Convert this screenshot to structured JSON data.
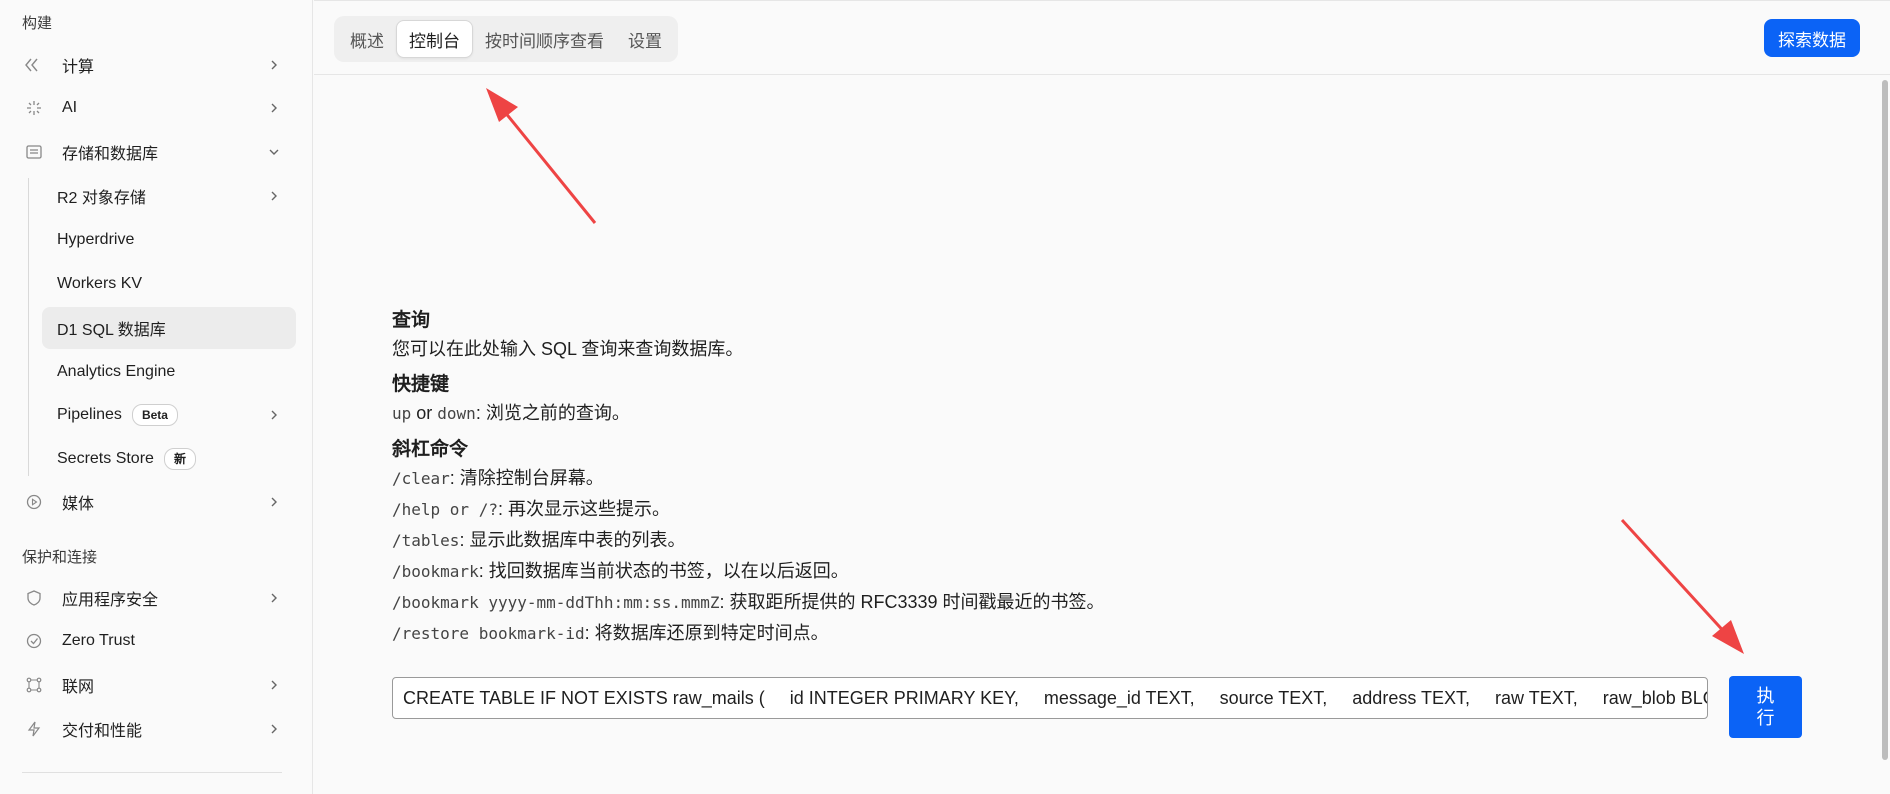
{
  "sidebar": {
    "section_build": "构建",
    "section_protect": "保护和连接",
    "items": {
      "compute": "计算",
      "ai": "AI",
      "storage": "存储和数据库",
      "media": "媒体",
      "app_security": "应用程序安全",
      "zero_trust": "Zero Trust",
      "network": "联网",
      "delivery": "交付和性能"
    },
    "storage_sub": {
      "r2": "R2 对象存储",
      "hyperdrive": "Hyperdrive",
      "workers_kv": "Workers KV",
      "d1": "D1 SQL 数据库",
      "analytics": "Analytics Engine",
      "pipelines": "Pipelines",
      "pipelines_badge": "Beta",
      "secrets": "Secrets Store",
      "secrets_badge": "新"
    }
  },
  "tabs": {
    "overview": "概述",
    "console": "控制台",
    "time_travel": "按时间顺序查看",
    "settings": "设置"
  },
  "explore_button": "探索数据",
  "help": {
    "query_title": "查询",
    "query_desc": "您可以在此处输入 SQL 查询来查询数据库。",
    "shortcut_title": "快捷键",
    "shortcut_up": "up",
    "shortcut_or": " or ",
    "shortcut_down": "down",
    "shortcut_desc": ": 浏览之前的查询。",
    "slash_title": "斜杠命令",
    "cmds": [
      {
        "cmd": "/clear",
        "desc": ": 清除控制台屏幕。"
      },
      {
        "cmd": "/help or /?",
        "desc": ": 再次显示这些提示。"
      },
      {
        "cmd": "/tables",
        "desc": ": 显示此数据库中表的列表。"
      },
      {
        "cmd": "/bookmark",
        "desc": ": 找回数据库当前状态的书签，以在以后返回。"
      },
      {
        "cmd": "/bookmark yyyy-mm-ddThh:mm:ss.mmmZ",
        "desc": ": 获取距所提供的 RFC3339 时间戳最近的书签。"
      },
      {
        "cmd": "/restore bookmark-id",
        "desc": ": 将数据库还原到特定时间点。"
      }
    ]
  },
  "query_value": "CREATE TABLE IF NOT EXISTS raw_mails (     id INTEGER PRIMARY KEY,     message_id TEXT,     source TEXT,     address TEXT,     raw TEXT,     raw_blob BLOB,     m",
  "run_button": "执行",
  "colors": {
    "accent": "#0b63f6",
    "arrow": "#ee4444"
  }
}
